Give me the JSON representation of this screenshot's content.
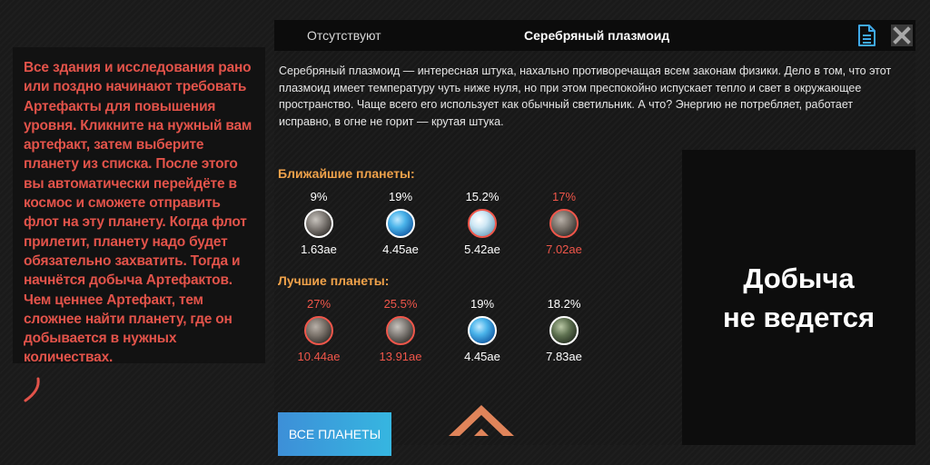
{
  "tutorial": {
    "text": "Все здания и исследования рано или поздно начинают требовать Артефакты для повышения уровня. Кликните на нужный вам артефакт, затем выберите планету из списка.  После этого вы автоматически перейдёте в космос и сможете отправить флот на эту планету. Когда флот прилетит, планету надо будет обязательно захватить. Тогда и начнётся добыча Артефактов. Чем ценнее Артефакт, тем сложнее найти планету, где он добывается в нужных количествах."
  },
  "header": {
    "tab_absent": "Отсутствуют",
    "title": "Серебряный плазмоид",
    "doc_icon": "document-icon",
    "close_icon": "close-icon"
  },
  "description": "Серебряный плазмоид — интересная штука, нахально противоречащая всем законам физики. Дело в том, что этот плазмоид имеет температуру чуть ниже нуля, но при этом преспокойно испускает тепло и свет в окружающее пространство. Чаще всего его использует как обычный светильник. А что? Энергию не потребляет, работает исправно, в огне не горит — крутая штука.",
  "nearest": {
    "title": "Ближайшие планеты:",
    "planets": [
      {
        "percent": "9%",
        "distance": "1.63ае",
        "highlight": "white",
        "texture": "gray"
      },
      {
        "percent": "19%",
        "distance": "4.45ае",
        "highlight": "white",
        "texture": "blue"
      },
      {
        "percent": "15.2%",
        "distance": "5.42ае",
        "highlight": "white",
        "texture": "ice"
      },
      {
        "percent": "17%",
        "distance": "7.02ае",
        "highlight": "red",
        "texture": "rock"
      }
    ]
  },
  "best": {
    "title": "Лучшие планеты:",
    "planets": [
      {
        "percent": "27%",
        "distance": "10.44ае",
        "highlight": "red",
        "texture": "rock"
      },
      {
        "percent": "25.5%",
        "distance": "13.91ае",
        "highlight": "red",
        "texture": "gray"
      },
      {
        "percent": "19%",
        "distance": "4.45ае",
        "highlight": "white",
        "texture": "blue"
      },
      {
        "percent": "18.2%",
        "distance": "7.83ае",
        "highlight": "white",
        "texture": "green"
      }
    ]
  },
  "all_planets_label": "ВСЕ ПЛАНЕТЫ",
  "mining_status": "Добыча\nне ведется",
  "colors": {
    "accent_orange": "#f0a24a",
    "alert_red": "#f0564a",
    "button_blue": "#3d8fd8",
    "tutorial_red": "#e2534a"
  }
}
